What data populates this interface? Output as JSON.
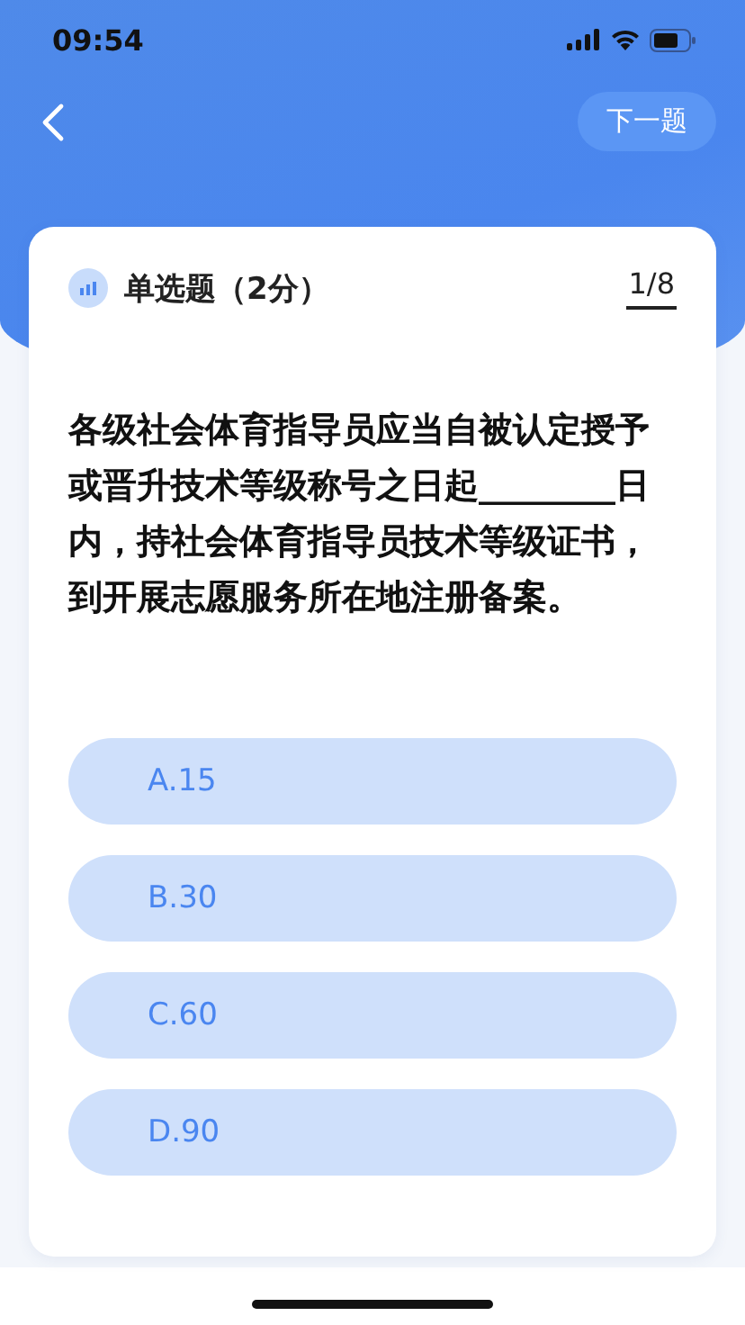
{
  "status_bar": {
    "time": "09:54"
  },
  "nav": {
    "next_button": "下一题"
  },
  "question": {
    "type_label": "单选题（2分）",
    "progress": "1/8",
    "text": "各级社会体育指导员应当自被认定授予或晋升技术等级称号之日起________日内，持社会体育指导员技术等级证书，到开展志愿服务所在地注册备案。"
  },
  "options": [
    {
      "label": "A.15",
      "selected": false
    },
    {
      "label": "B.30",
      "selected": false
    },
    {
      "label": "C.60",
      "selected": false
    },
    {
      "label": "D.90",
      "selected": false
    }
  ]
}
